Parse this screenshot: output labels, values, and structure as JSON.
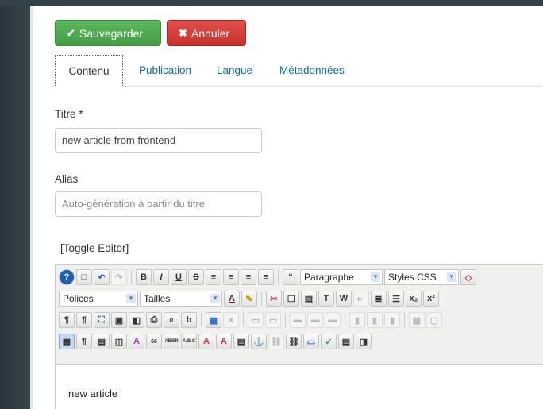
{
  "toolbar": {
    "save_label": "Sauvegarder",
    "cancel_label": "Annuler"
  },
  "tabs": [
    {
      "label": "Contenu",
      "active": true
    },
    {
      "label": "Publication",
      "active": false
    },
    {
      "label": "Langue",
      "active": false
    },
    {
      "label": "Métadonnées",
      "active": false
    }
  ],
  "fields": {
    "title_label": "Titre *",
    "title_value": "new article from frontend",
    "alias_label": "Alias",
    "alias_placeholder": "Auto-génération à partir du titre"
  },
  "editor": {
    "toggle_label": "[Toggle Editor]",
    "format_select": "Paragraphe",
    "styles_select": "Styles CSS",
    "fonts_select": "Polices",
    "sizes_select": "Tailles",
    "content": "new article"
  },
  "colors": {
    "save": "#5cb85c",
    "cancel": "#d9534f",
    "link": "#0a6aab"
  }
}
